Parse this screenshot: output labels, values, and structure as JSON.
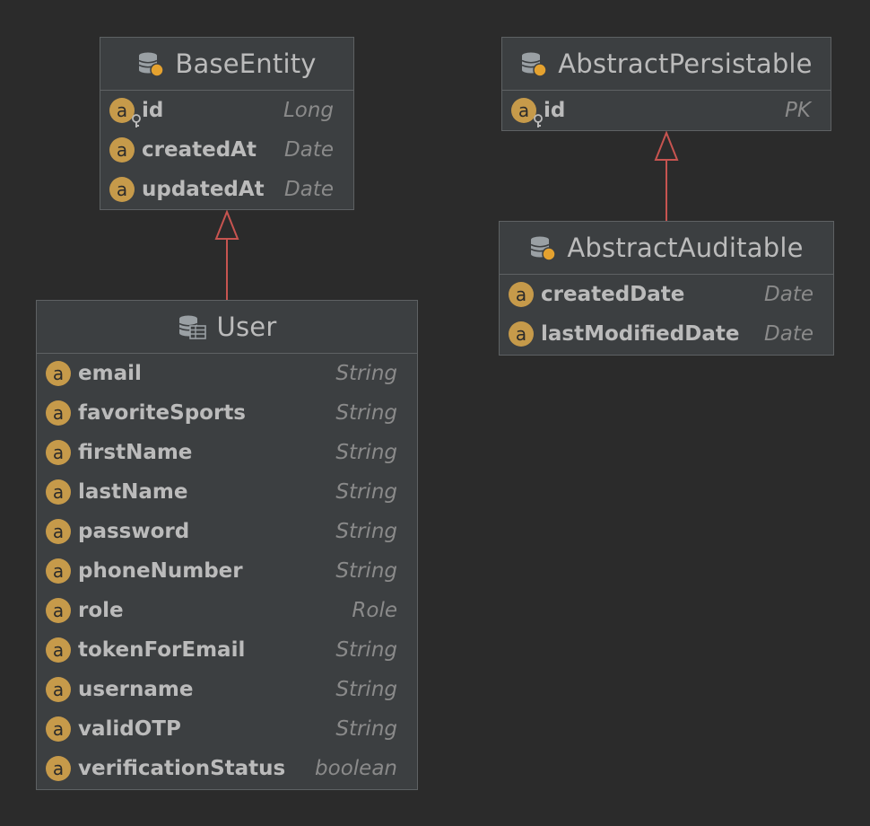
{
  "entities": {
    "base_entity": {
      "title": "BaseEntity",
      "fields": [
        {
          "name": "id",
          "type": "Long"
        },
        {
          "name": "createdAt",
          "type": "Date"
        },
        {
          "name": "updatedAt",
          "type": "Date"
        }
      ]
    },
    "abstract_persistable": {
      "title": "AbstractPersistable",
      "fields": [
        {
          "name": "id",
          "type": "PK"
        }
      ]
    },
    "abstract_auditable": {
      "title": "AbstractAuditable",
      "fields": [
        {
          "name": "createdDate",
          "type": "Date"
        },
        {
          "name": "lastModifiedDate",
          "type": "Date"
        }
      ]
    },
    "user": {
      "title": "User",
      "fields": [
        {
          "name": "email",
          "type": "String"
        },
        {
          "name": "favoriteSports",
          "type": "String"
        },
        {
          "name": "firstName",
          "type": "String"
        },
        {
          "name": "lastName",
          "type": "String"
        },
        {
          "name": "password",
          "type": "String"
        },
        {
          "name": "phoneNumber",
          "type": "String"
        },
        {
          "name": "role",
          "type": "Role"
        },
        {
          "name": "tokenForEmail",
          "type": "String"
        },
        {
          "name": "username",
          "type": "String"
        },
        {
          "name": "validOTP",
          "type": "String"
        },
        {
          "name": "verificationStatus",
          "type": "boolean"
        }
      ]
    }
  },
  "field_icon_letter": "a",
  "icons": {
    "entity_icon": "database-icon",
    "user_entity_icon": "database-table-icon",
    "field_icon": "attribute-icon",
    "primary_key_icon": "key-icon"
  },
  "colors": {
    "background": "#2b2b2b",
    "box": "#3c3f41",
    "border": "#5e6163",
    "attribute_icon": "#c69a4a",
    "inheritance_arrow": "#c75450",
    "text": "#bbbbbb",
    "type_text": "#8a8a8a"
  }
}
